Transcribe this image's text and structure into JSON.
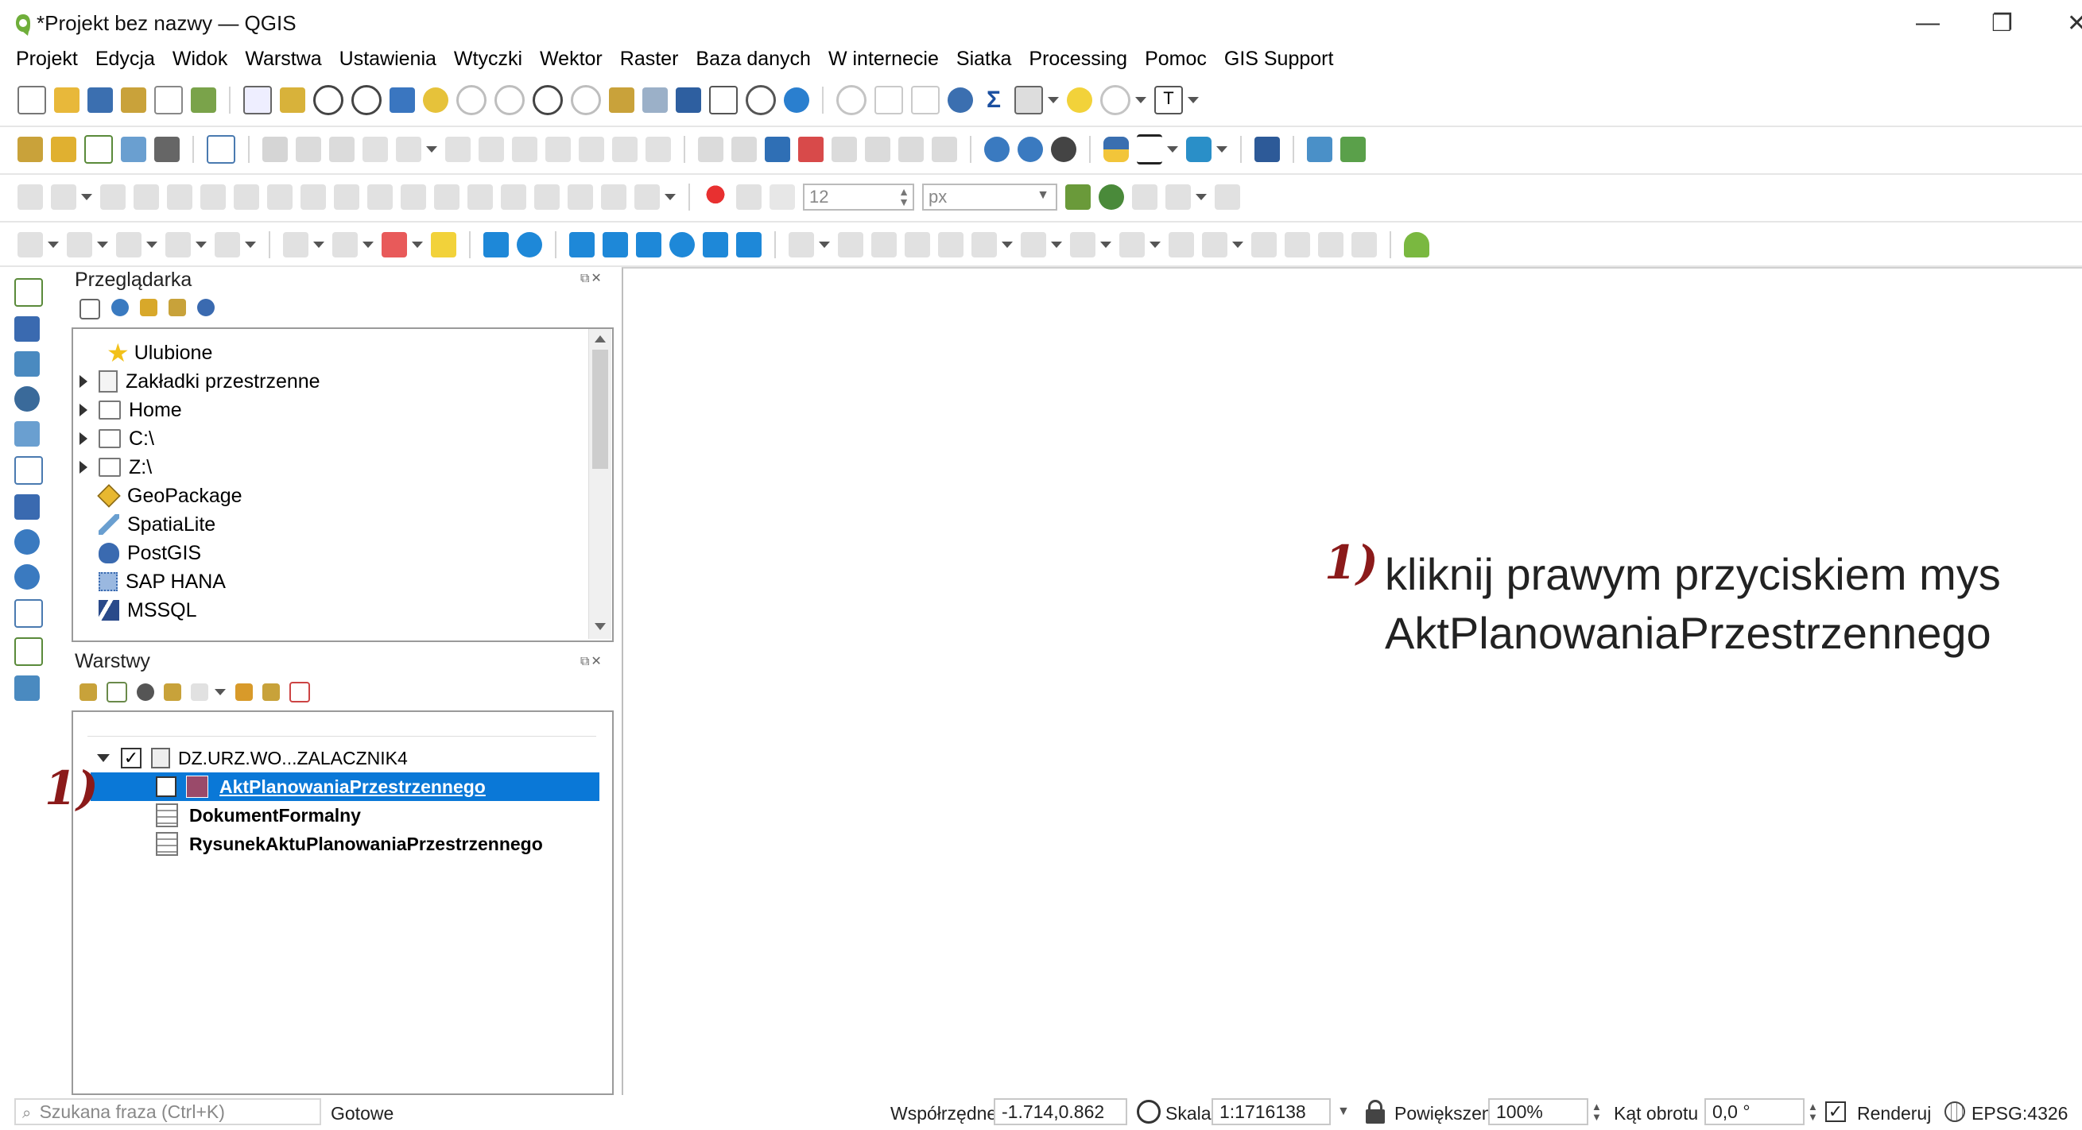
{
  "window": {
    "title": "*Projekt bez nazwy — QGIS",
    "minimize": "—",
    "maximize": "❐",
    "close": "✕"
  },
  "menu": [
    {
      "label": "Projekt"
    },
    {
      "label": "Edycja"
    },
    {
      "label": "Widok"
    },
    {
      "label": "Warstwa"
    },
    {
      "label": "Ustawienia"
    },
    {
      "label": "Wtyczki"
    },
    {
      "label": "Wektor"
    },
    {
      "label": "Raster"
    },
    {
      "label": "Baza danych"
    },
    {
      "label": "W internecie"
    },
    {
      "label": "Siatka"
    },
    {
      "label": "Processing"
    },
    {
      "label": "Pomoc"
    },
    {
      "label": "GIS Support"
    }
  ],
  "toolbars": {
    "snap_tolerance": "12",
    "snap_unit": "px"
  },
  "browser_panel": {
    "title": "Przeglądarka",
    "items": [
      {
        "label": "Ulubione",
        "icon": "star-icon"
      },
      {
        "label": "Zakładki przestrzenne",
        "icon": "bookmark-icon"
      },
      {
        "label": "Home",
        "icon": "home-icon"
      },
      {
        "label": "C:\\",
        "icon": "folder-icon"
      },
      {
        "label": "Z:\\",
        "icon": "folder-icon"
      },
      {
        "label": "GeoPackage",
        "icon": "geopackage-icon"
      },
      {
        "label": "SpatiaLite",
        "icon": "spatialite-icon"
      },
      {
        "label": "PostGIS",
        "icon": "postgis-icon"
      },
      {
        "label": "SAP HANA",
        "icon": "saphana-icon"
      },
      {
        "label": "MSSQL",
        "icon": "mssql-icon"
      }
    ]
  },
  "layers_panel": {
    "title": "Warstwy",
    "group": "DZ.URZ.WO...ZALACZNIK4",
    "layers": [
      {
        "label": "AktPlanowaniaPrzestrzennego",
        "checked": true,
        "selected": true
      },
      {
        "label": "DokumentFormalny"
      },
      {
        "label": "RysunekAktuPlanowaniaPrzestrzennego"
      }
    ]
  },
  "annotation": {
    "marker": "1)",
    "text_line1": "kliknij prawym przyciskiem mys",
    "text_line2": "AktPlanowaniaPrzestrzennego"
  },
  "statusbar": {
    "search_placeholder": "Szukana fraza (Ctrl+K)",
    "status": "Gotowe",
    "coords_label": "Współrzędne",
    "coords_value": "-1.714,0.862",
    "scale_label": "Skala",
    "scale_value": "1:1716138",
    "zoom_label": "Powiększenie",
    "zoom_value": "100%",
    "rotation_label": "Kąt obrotu",
    "rotation_value": "0,0 °",
    "render_label": "Renderuj",
    "crs": "EPSG:4326"
  },
  "colors": {
    "selection": "#0a78d7",
    "annotation": "#8b1a1a",
    "accent": "#1e6fb8"
  }
}
